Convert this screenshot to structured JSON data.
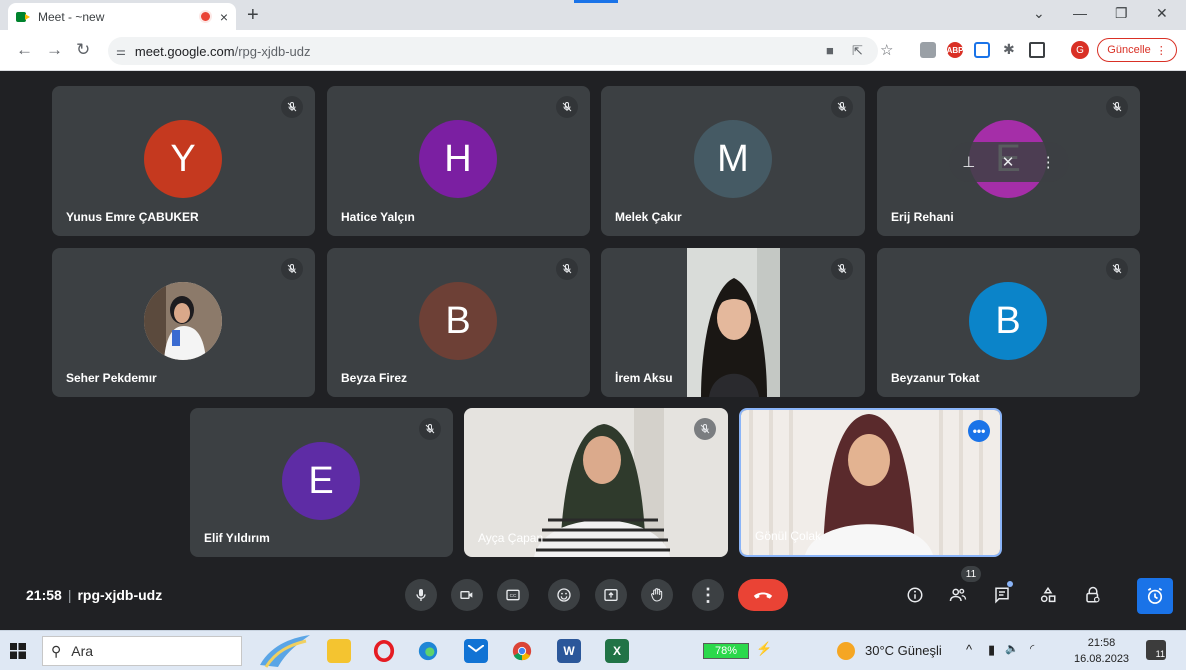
{
  "browser": {
    "tab_title": "Meet - ~new",
    "tab_close": "×",
    "new_tab": "+",
    "window_controls": {
      "minimize": "—",
      "restore": "❐",
      "close": "✕",
      "tab_list": "⌄"
    },
    "url_host": "meet.google.com",
    "url_path": "/rpg-xjdb-udz",
    "update_button": "Güncelle",
    "profile_initial": "G",
    "extensions": [
      "abp-icon",
      "screen-icon",
      "puzzle-icon",
      "sidepanel-icon"
    ]
  },
  "meeting": {
    "time": "21:58",
    "code": "rpg-xjdb-udz",
    "participant_count": "11",
    "participants": [
      {
        "name": "Yunus Emre ÇABUKER",
        "initial": "Y",
        "color": "#c5391f",
        "muted": true
      },
      {
        "name": "Hatice Yalçın",
        "initial": "H",
        "color": "#7b1fa2",
        "muted": true
      },
      {
        "name": "Melek Çakır",
        "initial": "M",
        "color": "#455a64",
        "muted": true
      },
      {
        "name": "Erij Rehani",
        "initial": "E",
        "color": "#a52ea8",
        "muted": true
      },
      {
        "name": "Seher Pekdemır",
        "initial": "",
        "color": "#ffffff",
        "muted": true
      },
      {
        "name": "Beyza Firez",
        "initial": "B",
        "color": "#6d4036",
        "muted": true
      },
      {
        "name": "İrem Aksu",
        "initial": "",
        "color": "#d9dcd9",
        "muted": true
      },
      {
        "name": "Beyzanur Tokat",
        "initial": "B",
        "color": "#0b84c9",
        "muted": true
      },
      {
        "name": "Elif Yıldırım",
        "initial": "E",
        "color": "#5e2ca5",
        "muted": true
      },
      {
        "name": "Ayça Çapan",
        "initial": "",
        "color": "#e5e3df",
        "muted": true
      },
      {
        "name": "Gönül Çolak",
        "initial": "",
        "color": "#f1ede9",
        "muted": false
      }
    ]
  },
  "taskbar": {
    "search_placeholder": "Ara",
    "battery": "78%",
    "weather": "30°C  Güneşli",
    "clock_time": "21:58",
    "clock_date": "16.08.2023",
    "notification_count": "11"
  }
}
